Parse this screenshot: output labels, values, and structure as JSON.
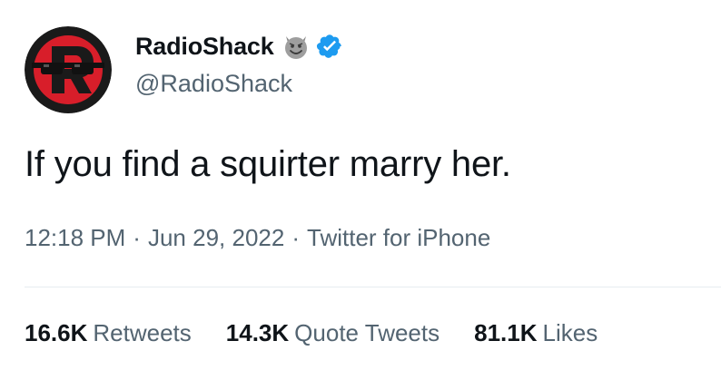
{
  "author": {
    "display_name": "RadioShack",
    "handle": "@RadioShack",
    "name_emoji_icon": "smiling-devil-icon",
    "verified_badge_icon": "verified-badge-icon",
    "avatar_icon": "radioshack-logo-sunglasses-icon"
  },
  "tweet": {
    "text": "If you find a squirter marry her."
  },
  "meta": {
    "time": "12:18 PM",
    "date": "Jun 29, 2022",
    "source": "Twitter for iPhone",
    "separator": "·"
  },
  "stats": {
    "retweets_count": "16.6K",
    "retweets_label": "Retweets",
    "quote_tweets_count": "14.3K",
    "quote_tweets_label": "Quote Tweets",
    "likes_count": "81.1K",
    "likes_label": "Likes"
  },
  "colors": {
    "text_primary": "#0f1419",
    "text_secondary": "#536471",
    "verified_blue": "#1d9bf0",
    "brand_red": "#d81e2a",
    "divider": "#e6ecf0"
  }
}
